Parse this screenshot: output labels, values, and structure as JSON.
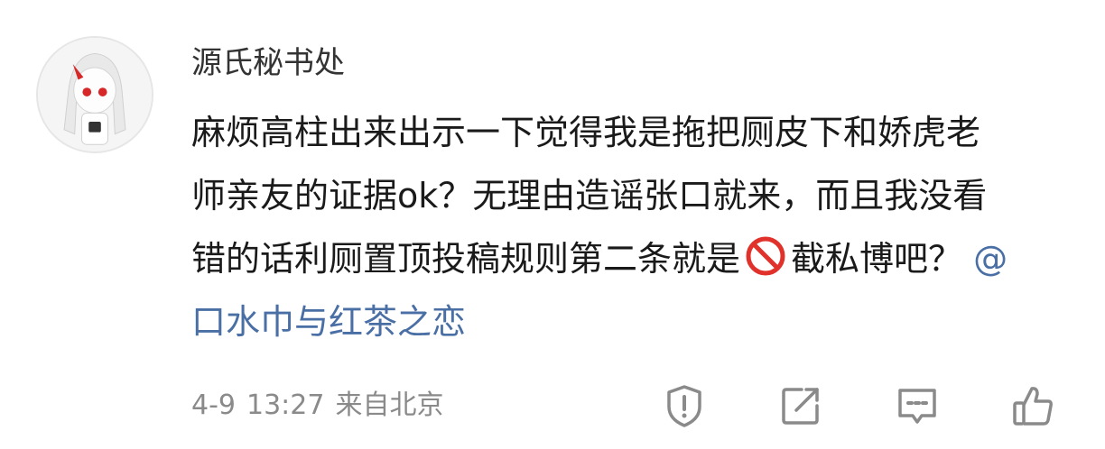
{
  "comment": {
    "author": "源氏秘书处",
    "lines": [
      "麻烦高柱出来出示一下觉得我是拖把厕皮下和娇虎老",
      "师亲友的证据ok？无理由造谣张口就来，而且我没看",
      "错的话利厕置顶投稿规则第二条就是",
      "截私博吧？"
    ],
    "mention_prefix": "@",
    "mention_name": "口水巾与红茶之恋",
    "date": "4-9",
    "time": "13:27",
    "location": "来自北京"
  },
  "icons": {
    "emoji": "prohibited-icon",
    "report": "report-icon",
    "repost": "repost-icon",
    "reply": "reply-icon",
    "like": "like-icon"
  },
  "colors": {
    "mention": "#4a6fa5",
    "meta": "#8a8a8a",
    "icon": "#8a8a8a",
    "prohibited": "#e0322b"
  }
}
